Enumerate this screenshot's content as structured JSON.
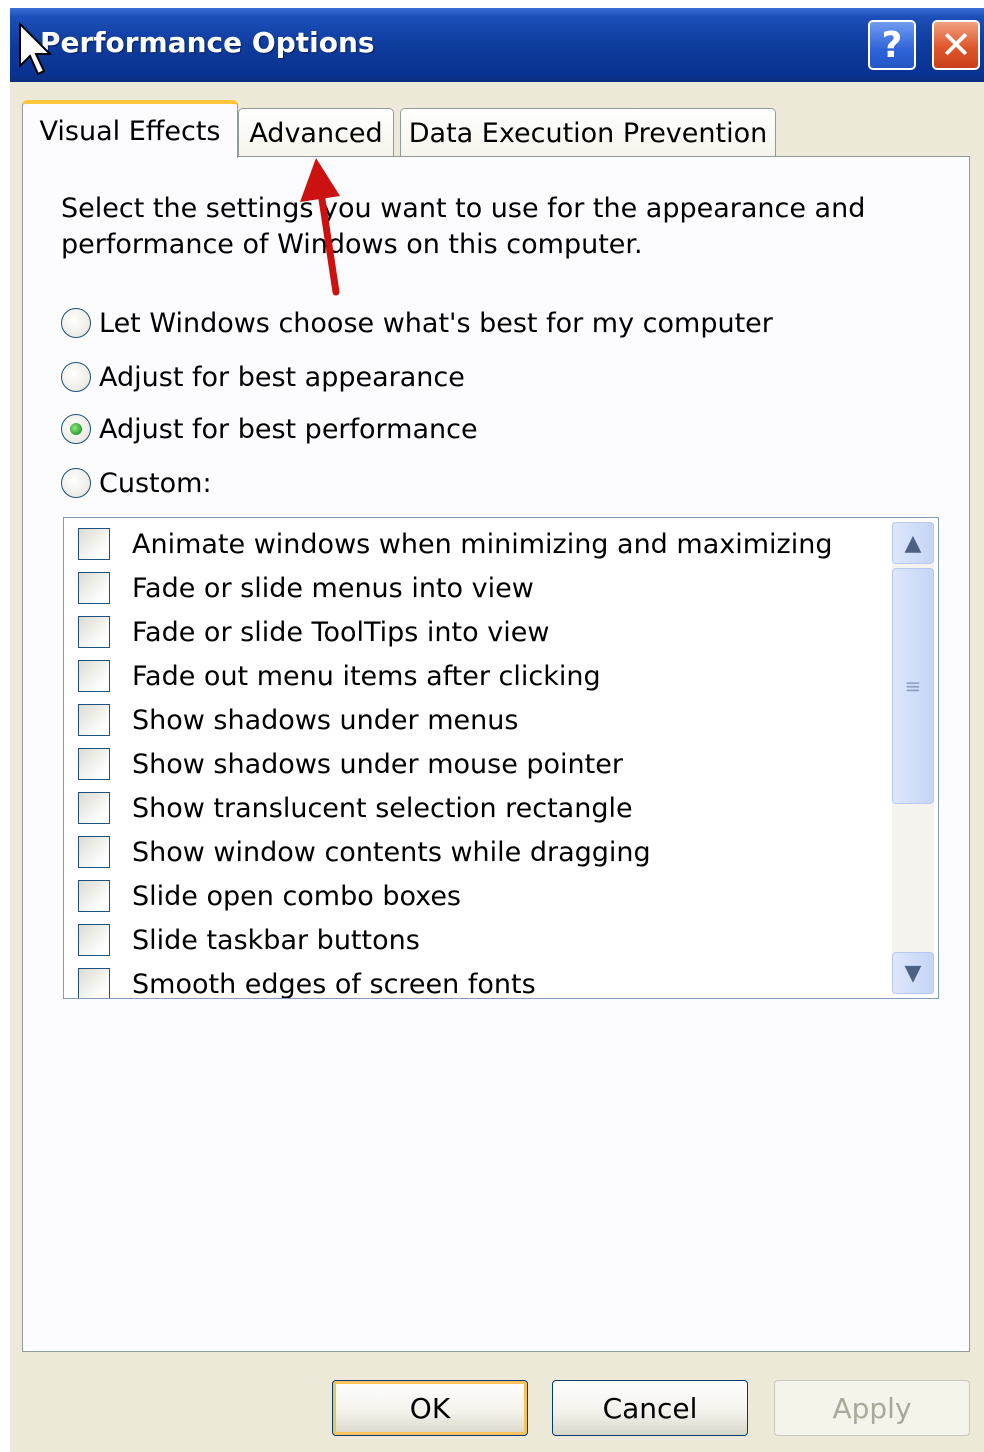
{
  "window": {
    "title": "Performance Options",
    "help_label": "?",
    "close_label": "✕"
  },
  "tabs": [
    {
      "label": "Visual Effects",
      "active": true
    },
    {
      "label": "Advanced",
      "active": false
    },
    {
      "label": "Data Execution Prevention",
      "active": false
    }
  ],
  "visual_effects": {
    "instructions_line1": "Select the settings you want to use for the appearance and",
    "instructions_line2": "performance of Windows on this computer.",
    "options": [
      {
        "label": "Let Windows choose what's best for my computer",
        "checked": false
      },
      {
        "label": "Adjust for best appearance",
        "checked": false
      },
      {
        "label": "Adjust for best performance",
        "checked": true
      },
      {
        "label": "Custom:",
        "checked": false
      }
    ],
    "effects": [
      {
        "label": "Animate windows when minimizing and maximizing",
        "checked": false
      },
      {
        "label": "Fade or slide menus into view",
        "checked": false
      },
      {
        "label": "Fade or slide ToolTips into view",
        "checked": false
      },
      {
        "label": "Fade out menu items after clicking",
        "checked": false
      },
      {
        "label": "Show shadows under menus",
        "checked": false
      },
      {
        "label": "Show shadows under mouse pointer",
        "checked": false
      },
      {
        "label": "Show translucent selection rectangle",
        "checked": false
      },
      {
        "label": "Show window contents while dragging",
        "checked": false
      },
      {
        "label": "Slide open combo boxes",
        "checked": false
      },
      {
        "label": "Slide taskbar buttons",
        "checked": false
      },
      {
        "label": "Smooth edges of screen fonts",
        "checked": false
      }
    ]
  },
  "buttons": {
    "ok": "OK",
    "cancel": "Cancel",
    "apply": "Apply"
  },
  "colors": {
    "annotation_arrow": "#cc1111",
    "titlebar": "#0e3c9e",
    "tab_highlight": "#ffc83c"
  }
}
